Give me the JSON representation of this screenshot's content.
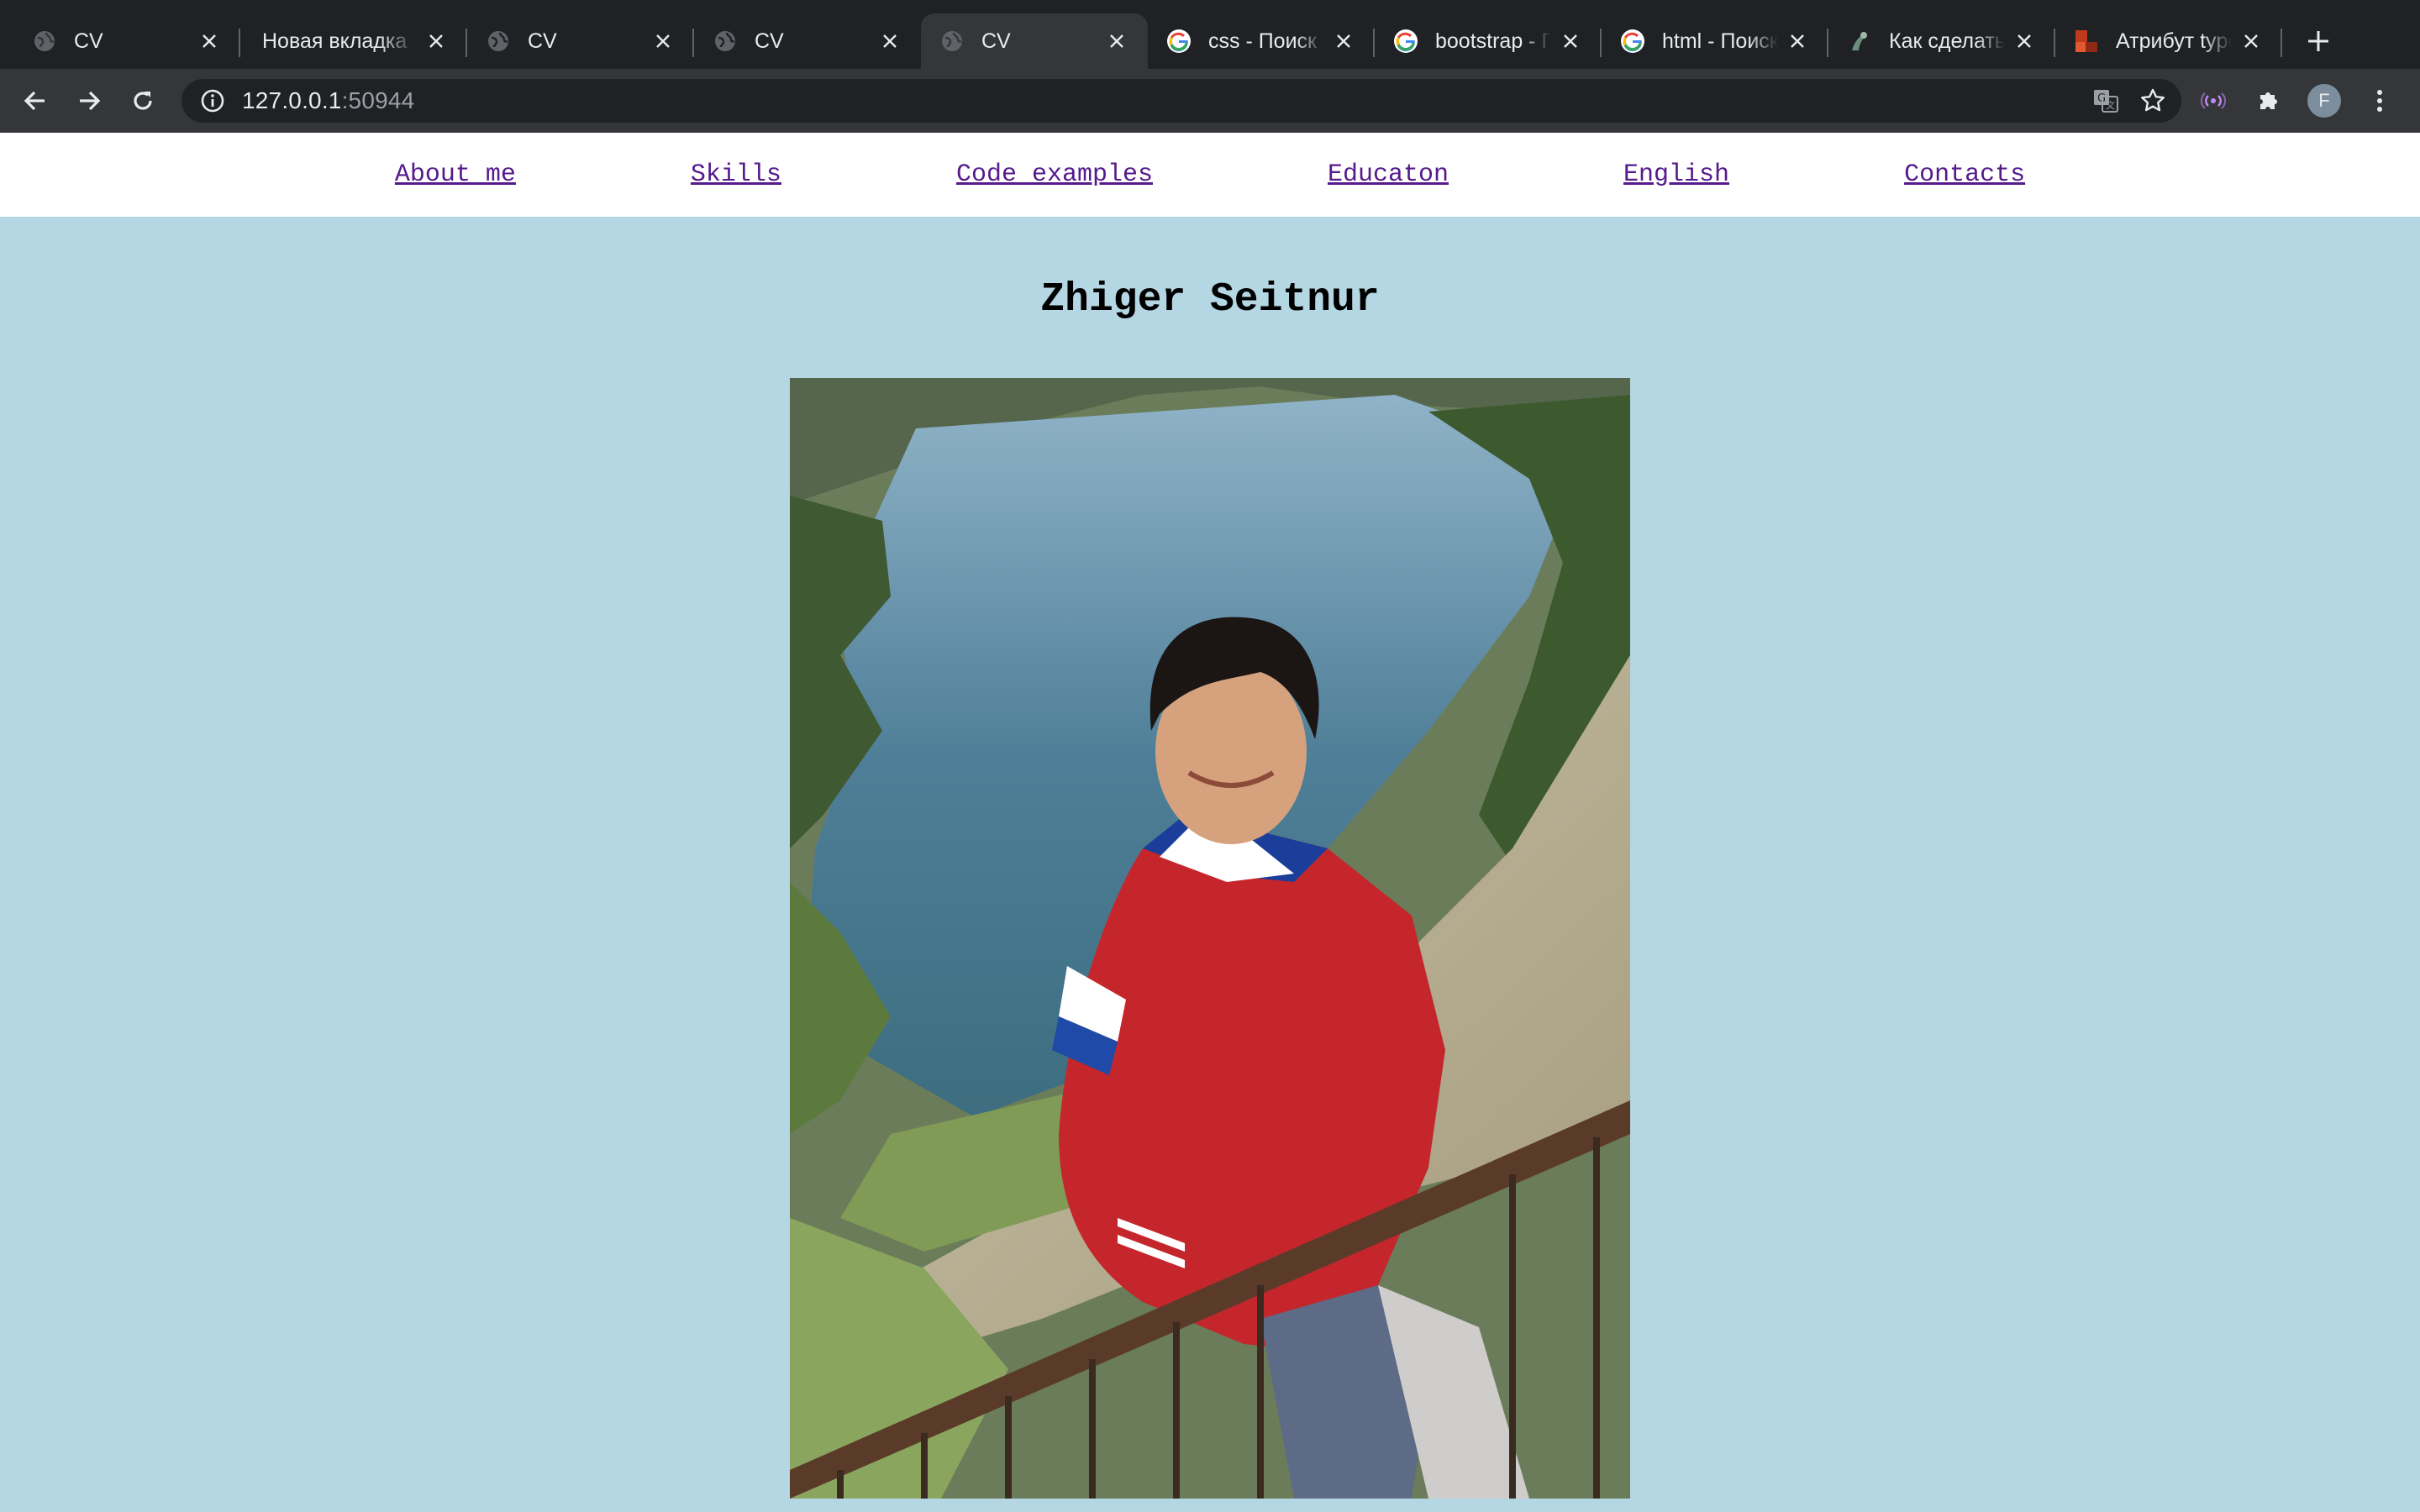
{
  "browser": {
    "tabs": [
      {
        "title": "CV",
        "favicon": "globe-icon"
      },
      {
        "title": "Новая вкладка",
        "favicon": "none"
      },
      {
        "title": "CV",
        "favicon": "globe-icon"
      },
      {
        "title": "CV",
        "favicon": "globe-icon"
      },
      {
        "title": "CV",
        "favicon": "globe-icon",
        "active": true
      },
      {
        "title": "css - Поиск в Google",
        "favicon": "google-icon"
      },
      {
        "title": "bootstrap - Поиск в Google",
        "favicon": "google-icon"
      },
      {
        "title": "html - Поиск в Google",
        "favicon": "google-icon"
      },
      {
        "title": "Как сделать",
        "favicon": "site-icon"
      },
      {
        "title": "Атрибут type",
        "favicon": "htmlbook-icon"
      }
    ],
    "url_host": "127.0.0.1",
    "url_port": ":50944",
    "profile_initial": "F",
    "accent_color": "#b4d7e3"
  },
  "nav": {
    "items": [
      "About me",
      "Skills",
      "Code examples",
      "Educaton",
      "English",
      "Contacts"
    ]
  },
  "header": {
    "name": "Zhiger Seitnur"
  }
}
